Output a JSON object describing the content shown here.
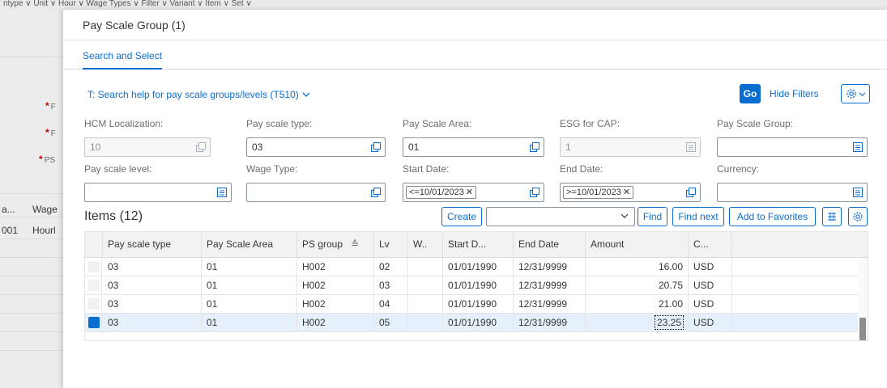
{
  "background": {
    "topbar_text": "ntype ∨   Unit ∨   Hour ∨   Wage Types ∨   Filter ∨   Variant ∨   Item ∨   Set ∨",
    "labels": [
      "*",
      "*",
      "*"
    ],
    "label_suffixes": [
      "F",
      "F",
      "PS"
    ],
    "column_text": [
      "a...",
      "Wage"
    ],
    "row_text": [
      "001",
      "Hourl"
    ]
  },
  "dialog": {
    "title": "Pay Scale Group (1)",
    "tab": "Search and Select",
    "variant": "T: Search help for pay scale groups/levels (T510)",
    "go": "Go",
    "hide_filters": "Hide Filters"
  },
  "filters": [
    {
      "label": "HCM Localization:",
      "value": "10",
      "disabled": true
    },
    {
      "label": "Pay scale type:",
      "value": "03"
    },
    {
      "label": "Pay Scale Area:",
      "value": "01"
    },
    {
      "label": "ESG for CAP:",
      "value": "1",
      "disabled": true
    },
    {
      "label": "Pay Scale Group:",
      "value": ""
    },
    {
      "label": "Pay scale level:",
      "value": ""
    },
    {
      "label": "Wage Type:",
      "value": ""
    },
    {
      "label": "Start Date:",
      "token": "<=10/01/2023"
    },
    {
      "label": "End Date:",
      "token": ">=10/01/2023"
    },
    {
      "label": "Currency:",
      "value": ""
    }
  ],
  "table_toolbar": {
    "title": "Items (12)",
    "create": "Create",
    "find": "Find",
    "find_next": "Find next",
    "add_favorites": "Add to Favorites"
  },
  "table": {
    "columns": [
      "Pay scale type",
      "Pay Scale Area",
      "PS group",
      "Lv",
      "W..",
      "Start D...",
      "End Date",
      "Amount",
      "C..."
    ],
    "rows": [
      [
        "03",
        "01",
        "H002",
        "02",
        "",
        "01/01/1990",
        "12/31/9999",
        "16.00",
        "USD"
      ],
      [
        "03",
        "01",
        "H002",
        "03",
        "",
        "01/01/1990",
        "12/31/9999",
        "20.75",
        "USD"
      ],
      [
        "03",
        "01",
        "H002",
        "04",
        "",
        "01/01/1990",
        "12/31/9999",
        "21.00",
        "USD"
      ],
      [
        "03",
        "01",
        "H002",
        "05",
        "",
        "01/01/1990",
        "12/31/9999",
        "23.25",
        "USD"
      ]
    ],
    "selected_row": 3,
    "sort_indicator": "≙"
  },
  "colors": {
    "accent": "#0a6ed1",
    "selection": "#e5f0fa"
  }
}
